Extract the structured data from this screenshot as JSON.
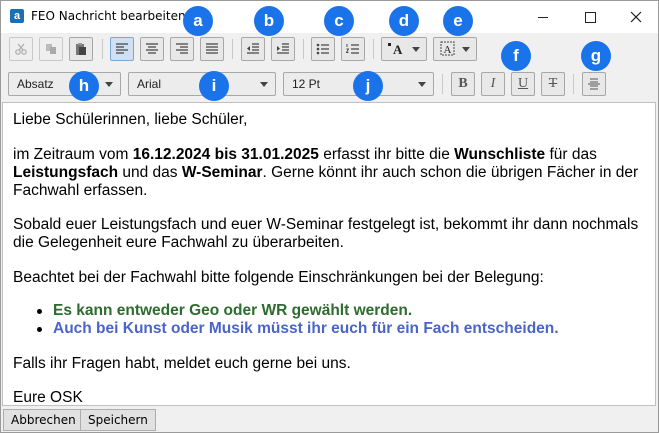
{
  "window": {
    "title": "FEO Nachricht bearbeiten",
    "icon_letter": "a"
  },
  "toolbar": {
    "paragraph_style": "Absatz",
    "font_family": "Arial",
    "font_size": "12 Pt",
    "bold_label": "B",
    "italic_label": "I",
    "underline_label": "U",
    "strike_label": "T"
  },
  "badges": {
    "a": "a",
    "b": "b",
    "c": "c",
    "d": "d",
    "e": "e",
    "f": "f",
    "g": "g",
    "h": "h",
    "i": "i",
    "j": "j"
  },
  "message": {
    "greeting": "Liebe Schülerinnen, liebe Schüler,",
    "p1_a": "im Zeitraum vom ",
    "p1_dates": "16.12.2024 bis 31.01.2025",
    "p1_b": " erfasst ihr bitte die ",
    "p1_wish": "Wunschliste",
    "p1_c": " für das ",
    "p1_lf": "Leistungsfach",
    "p1_d": " und das ",
    "p1_ws": "W-Seminar",
    "p1_e": ". Gerne könnt ihr auch schon die übrigen Fächer in der Fachwahl erfassen.",
    "p2": "Sobald euer Leistungsfach und euer W-Seminar festgelegt ist, bekommt ihr dann nochmals die Gelegenheit eure Fachwahl zu überarbeiten.",
    "p3": "Beachtet bei der Fachwahl bitte folgende Einschränkungen bei der Belegung:",
    "bullets": [
      {
        "text": "Es kann entweder Geo oder WR gewählt werden.",
        "color": "#2e6b2e"
      },
      {
        "text": "Auch bei Kunst oder Musik müsst ihr euch für ein Fach entscheiden.",
        "color": "#4a64c8"
      }
    ],
    "p4": "Falls ihr Fragen habt, meldet euch gerne bei uns.",
    "signature": "Eure OSK"
  },
  "footer": {
    "cancel_label": "Abbrechen",
    "save_label": "Speichern"
  },
  "colors": {
    "badge": "#1a73e8",
    "active_button": "#cfe0f3"
  }
}
